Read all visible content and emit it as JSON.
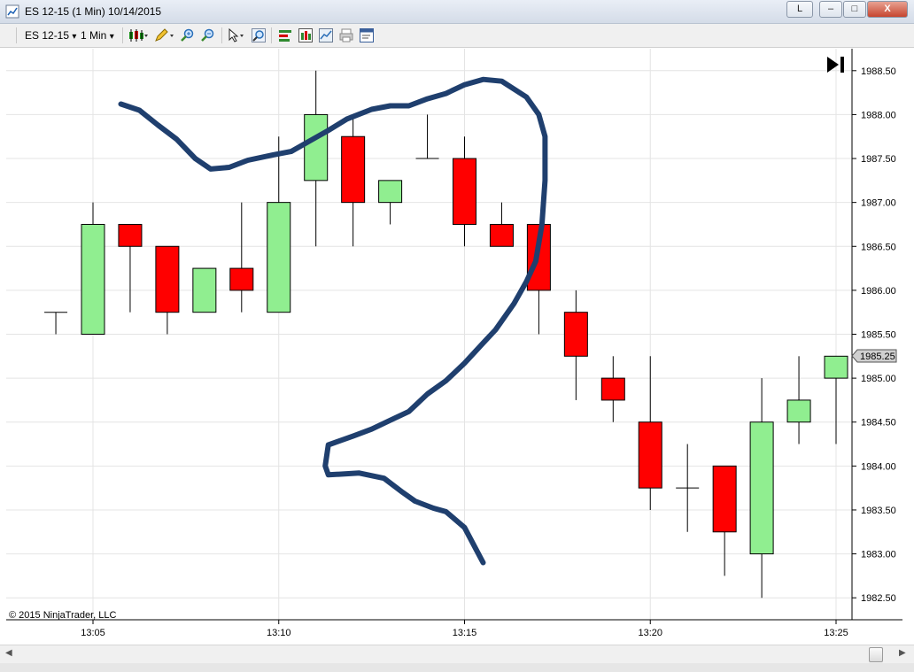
{
  "window": {
    "title": "ES 12-15 (1 Min)  10/14/2015",
    "buttons": {
      "l": "L",
      "minimize": "–",
      "maximize": "□",
      "close": "X"
    }
  },
  "toolbar": {
    "instrument": "ES 12-15",
    "interval": "1 Min",
    "dropdown_glyph": "▾",
    "icons": [
      "candlestick-style-icon",
      "pencil-draw-icon",
      "zoom-in-icon",
      "zoom-out-icon",
      "cursor-pointer-icon",
      "magnifier-icon",
      "bar-style-icon",
      "chart-properties-icon",
      "data-box-icon",
      "print-icon",
      "window-icon"
    ]
  },
  "chart_data": {
    "type": "candlestick",
    "copyright": "© 2015 NinjaTrader, LLC",
    "x_ticks": [
      "13:05",
      "13:10",
      "13:15",
      "13:20",
      "13:25"
    ],
    "y_ticks": [
      "1982.50",
      "1983.00",
      "1983.50",
      "1984.00",
      "1984.50",
      "1985.00",
      "1985.50",
      "1986.00",
      "1986.50",
      "1987.00",
      "1987.50",
      "1988.00",
      "1988.50"
    ],
    "ylim": [
      1982.25,
      1988.75
    ],
    "grid": true,
    "last_price_label": "1985.25",
    "colors": {
      "up": "#90ee90",
      "down": "#ff0000",
      "doji": "#000000",
      "annotation": "#1f3f6e",
      "grid": "#e4e4e4"
    },
    "candles": [
      {
        "time": "13:04",
        "open": 1985.75,
        "high": 1985.75,
        "low": 1985.5,
        "close": 1985.75
      },
      {
        "time": "13:05",
        "open": 1985.5,
        "high": 1987.0,
        "low": 1985.5,
        "close": 1986.75
      },
      {
        "time": "13:06",
        "open": 1986.75,
        "high": 1986.75,
        "low": 1985.75,
        "close": 1986.5
      },
      {
        "time": "13:07",
        "open": 1986.5,
        "high": 1986.5,
        "low": 1985.5,
        "close": 1985.75
      },
      {
        "time": "13:08",
        "open": 1985.75,
        "high": 1986.25,
        "low": 1985.75,
        "close": 1986.25
      },
      {
        "time": "13:09",
        "open": 1986.25,
        "high": 1987.0,
        "low": 1985.75,
        "close": 1986.0
      },
      {
        "time": "13:10",
        "open": 1985.75,
        "high": 1987.75,
        "low": 1985.75,
        "close": 1987.0
      },
      {
        "time": "13:11",
        "open": 1987.25,
        "high": 1988.5,
        "low": 1986.5,
        "close": 1988.0
      },
      {
        "time": "13:12",
        "open": 1987.75,
        "high": 1988.0,
        "low": 1986.5,
        "close": 1987.0
      },
      {
        "time": "13:13",
        "open": 1987.0,
        "high": 1987.25,
        "low": 1986.75,
        "close": 1987.25
      },
      {
        "time": "13:14",
        "open": 1987.5,
        "high": 1988.0,
        "low": 1987.5,
        "close": 1987.5
      },
      {
        "time": "13:15",
        "open": 1987.5,
        "high": 1987.75,
        "low": 1986.5,
        "close": 1986.75
      },
      {
        "time": "13:16",
        "open": 1986.75,
        "high": 1987.0,
        "low": 1986.5,
        "close": 1986.5
      },
      {
        "time": "13:17",
        "open": 1986.75,
        "high": 1986.75,
        "low": 1985.5,
        "close": 1986.0
      },
      {
        "time": "13:18",
        "open": 1985.75,
        "high": 1986.0,
        "low": 1984.75,
        "close": 1985.25
      },
      {
        "time": "13:19",
        "open": 1985.0,
        "high": 1985.25,
        "low": 1984.5,
        "close": 1984.75
      },
      {
        "time": "13:20",
        "open": 1984.5,
        "high": 1985.25,
        "low": 1983.5,
        "close": 1983.75
      },
      {
        "time": "13:21",
        "open": 1983.75,
        "high": 1984.25,
        "low": 1983.25,
        "close": 1983.75
      },
      {
        "time": "13:22",
        "open": 1984.0,
        "high": 1984.0,
        "low": 1982.75,
        "close": 1983.25
      },
      {
        "time": "13:23",
        "open": 1983.0,
        "high": 1985.0,
        "low": 1982.5,
        "close": 1984.5
      },
      {
        "time": "13:24",
        "open": 1984.5,
        "high": 1985.25,
        "low": 1984.25,
        "close": 1984.75
      },
      {
        "time": "13:25",
        "open": 1985.0,
        "high": 1985.25,
        "low": 1984.25,
        "close": 1985.25
      }
    ],
    "annotation_path": [
      [
        "13:05:45",
        1988.12
      ],
      [
        "13:06:15",
        1988.05
      ],
      [
        "13:06:45",
        1987.88
      ],
      [
        "13:07:15",
        1987.72
      ],
      [
        "13:07:45",
        1987.5
      ],
      [
        "13:08:10",
        1987.38
      ],
      [
        "13:08:40",
        1987.4
      ],
      [
        "13:09:10",
        1987.48
      ],
      [
        "13:09:50",
        1987.54
      ],
      [
        "13:10:20",
        1987.58
      ],
      [
        "13:10:50",
        1987.7
      ],
      [
        "13:11:20",
        1987.82
      ],
      [
        "13:11:50",
        1987.95
      ],
      [
        "13:12:30",
        1988.06
      ],
      [
        "13:13:00",
        1988.1
      ],
      [
        "13:13:30",
        1988.1
      ],
      [
        "13:14:00",
        1988.18
      ],
      [
        "13:14:30",
        1988.24
      ],
      [
        "13:15:00",
        1988.34
      ],
      [
        "13:15:30",
        1988.4
      ],
      [
        "13:16:00",
        1988.38
      ],
      [
        "13:16:40",
        1988.2
      ],
      [
        "13:17:00",
        1988.0
      ],
      [
        "13:17:10",
        1987.75
      ],
      [
        "13:17:10",
        1987.25
      ],
      [
        "13:17:05",
        1986.75
      ],
      [
        "13:16:55",
        1986.33
      ],
      [
        "13:16:40",
        1986.1
      ],
      [
        "13:16:20",
        1985.85
      ],
      [
        "13:15:50",
        1985.55
      ],
      [
        "13:15:30",
        1985.4
      ],
      [
        "13:15:00",
        1985.17
      ],
      [
        "13:14:30",
        1984.97
      ],
      [
        "13:14:00",
        1984.82
      ],
      [
        "13:13:30",
        1984.62
      ],
      [
        "13:13:00",
        1984.52
      ],
      [
        "13:12:30",
        1984.42
      ],
      [
        "13:12:00",
        1984.34
      ],
      [
        "13:11:20",
        1984.24
      ],
      [
        "13:11:15",
        1984.0
      ],
      [
        "13:11:20",
        1983.9
      ],
      [
        "13:12:10",
        1983.92
      ],
      [
        "13:12:50",
        1983.86
      ],
      [
        "13:13:20",
        1983.7
      ],
      [
        "13:13:40",
        1983.6
      ],
      [
        "13:14:10",
        1983.52
      ],
      [
        "13:14:30",
        1983.48
      ],
      [
        "13:15:00",
        1983.3
      ],
      [
        "13:15:15",
        1983.1
      ],
      [
        "13:15:30",
        1982.9
      ]
    ]
  }
}
